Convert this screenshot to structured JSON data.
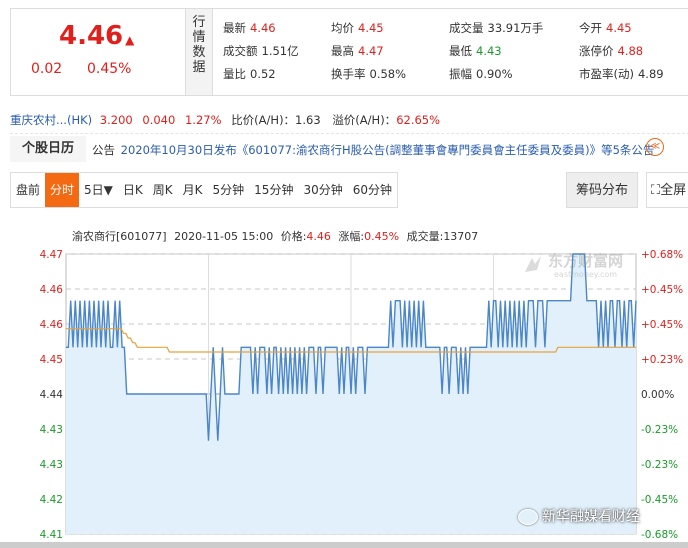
{
  "quote": {
    "price": "4.46",
    "up_icon": "▲",
    "change": "0.02",
    "change_pct": "0.45%",
    "vertical_label": [
      "行",
      "情",
      "数",
      "据"
    ],
    "fields": [
      {
        "label": "最新",
        "value": "4.46",
        "color": "red"
      },
      {
        "label": "均价",
        "value": "4.45",
        "color": "red"
      },
      {
        "label": "成交量",
        "value": "33.91万手",
        "color": ""
      },
      {
        "label": "今开",
        "value": "4.45",
        "color": "red"
      },
      {
        "label": "成交额",
        "value": "1.51亿",
        "color": ""
      },
      {
        "label": "最高",
        "value": "4.47",
        "color": "red"
      },
      {
        "label": "最低",
        "value": "4.43",
        "color": "green"
      },
      {
        "label": "涨停价",
        "value": "4.88",
        "color": "red"
      },
      {
        "label": "量比",
        "value": "0.52",
        "color": ""
      },
      {
        "label": "换手率",
        "value": "0.58%",
        "color": ""
      },
      {
        "label": "振幅",
        "value": "0.90%",
        "color": ""
      },
      {
        "label": "市盈率(动)",
        "value": "4.89",
        "color": ""
      }
    ]
  },
  "hk": {
    "name": "重庆农村...(HK)",
    "price": "3.200",
    "change": "0.040",
    "pct": "1.27%",
    "ratio_label": "比价(A/H)：1.63",
    "premium_label": "溢价(A/H)：",
    "premium_value": "62.65%"
  },
  "calendar": {
    "title": "个股日历",
    "prefix": "公告",
    "text": "2020年10月30日发布《601077:渝农商行H股公告(調整董事會專門委員會主任委員及委員)》等5条公告",
    "icon_text": "≪"
  },
  "tabs": [
    "盘前",
    "分时",
    "5日▼",
    "日K",
    "周K",
    "月K",
    "5分钟",
    "15分钟",
    "30分钟",
    "60分钟"
  ],
  "active_tab": "分时",
  "buttons": {
    "chip": "筹码分布",
    "full": "⛶全屏"
  },
  "chart_header": {
    "name": "渝农商行[601077]",
    "time": "2020-11-05 15:00",
    "price_label": "价格:",
    "price": "4.46",
    "pct_label": "涨幅:",
    "pct": "0.45%",
    "vol_label": "成交量:",
    "vol": "13707"
  },
  "watermark": {
    "brand": "东方财富网",
    "site": "eastmoney.com"
  },
  "credit": "新华融媒看财经",
  "colors": {
    "up": "#e0201d",
    "down": "#1a9a28",
    "price_line": "#4a86c8",
    "avg_line": "#e6a23c",
    "fill": "#e1f0fb",
    "grid": "#c8c8c8",
    "accent": "#f36a12"
  },
  "chart_data": {
    "type": "line",
    "title": "",
    "ylim": [
      4.41,
      4.47
    ],
    "left_ticks": [
      "4.47",
      "4.46",
      "4.46",
      "4.45",
      "4.44",
      "4.43",
      "4.43",
      "4.42",
      "4.41"
    ],
    "right_ticks": [
      "+0.68%",
      "+0.45%",
      "+0.45%",
      "+0.23%",
      "0.00%",
      "-0.23%",
      "-0.23%",
      "-0.45%",
      "-0.68%"
    ],
    "left_tick_values": [
      4.47,
      4.4625,
      4.455,
      4.4475,
      4.44,
      4.4325,
      4.425,
      4.4175,
      4.41
    ],
    "prev_close": 4.44,
    "x_index_range": [
      0,
      240
    ],
    "series": [
      {
        "values": [
          4.45,
          4.45,
          4.46,
          4.45,
          4.46,
          4.45,
          4.46,
          4.45,
          4.46,
          4.45,
          4.46,
          4.45,
          4.46,
          4.45,
          4.46,
          4.45,
          4.46,
          4.45,
          4.46,
          4.45,
          4.45,
          4.46,
          4.45,
          4.46,
          4.45,
          4.45,
          4.44,
          4.44,
          4.44,
          4.44,
          4.44,
          4.44,
          4.44,
          4.44,
          4.44,
          4.44,
          4.44,
          4.44,
          4.44,
          4.44,
          4.44,
          4.44,
          4.44,
          4.44,
          4.44,
          4.44,
          4.44,
          4.44,
          4.44,
          4.44,
          4.44,
          4.44,
          4.44,
          4.44,
          4.44,
          4.44,
          4.44,
          4.44,
          4.44,
          4.44,
          4.44,
          4.43,
          4.44,
          4.45,
          4.44,
          4.43,
          4.44,
          4.45,
          4.44,
          4.44,
          4.44,
          4.44,
          4.44,
          4.44,
          4.44,
          4.45,
          4.45,
          4.45,
          4.45,
          4.45,
          4.44,
          4.45,
          4.44,
          4.45,
          4.45,
          4.45,
          4.44,
          4.45,
          4.44,
          4.45,
          4.45,
          4.44,
          4.45,
          4.44,
          4.45,
          4.44,
          4.45,
          4.44,
          4.45,
          4.44,
          4.45,
          4.44,
          4.45,
          4.44,
          4.45,
          4.45,
          4.45,
          4.44,
          4.45,
          4.45,
          4.44,
          4.45,
          4.45,
          4.45,
          4.45,
          4.45,
          4.45,
          4.44,
          4.45,
          4.44,
          4.45,
          4.45,
          4.44,
          4.45,
          4.44,
          4.45,
          4.45,
          4.45,
          4.44,
          4.45,
          4.45,
          4.45,
          4.45,
          4.45,
          4.45,
          4.45,
          4.45,
          4.45,
          4.45,
          4.46,
          4.45,
          4.46,
          4.46,
          4.46,
          4.45,
          4.46,
          4.45,
          4.46,
          4.45,
          4.46,
          4.45,
          4.46,
          4.45,
          4.46,
          4.45,
          4.45,
          4.45,
          4.45,
          4.45,
          4.45,
          4.45,
          4.44,
          4.45,
          4.45,
          4.44,
          4.45,
          4.45,
          4.45,
          4.44,
          4.45,
          4.44,
          4.45,
          4.44,
          4.45,
          4.45,
          4.45,
          4.45,
          4.45,
          4.45,
          4.45,
          4.45,
          4.46,
          4.45,
          4.46,
          4.46,
          4.45,
          4.46,
          4.45,
          4.46,
          4.45,
          4.46,
          4.45,
          4.46,
          4.45,
          4.46,
          4.45,
          4.46,
          4.45,
          4.46,
          4.46,
          4.46,
          4.45,
          4.46,
          4.46,
          4.46,
          4.45,
          4.46,
          4.46,
          4.46,
          4.46,
          4.46,
          4.46,
          4.46,
          4.46,
          4.46,
          4.46,
          4.46,
          4.47,
          4.47,
          4.47,
          4.47,
          4.47,
          4.47,
          4.46,
          4.46,
          4.46,
          4.46,
          4.46,
          4.45,
          4.46,
          4.45,
          4.46,
          4.45,
          4.46,
          4.46,
          4.45,
          4.46,
          4.46,
          4.45,
          4.46,
          4.45,
          4.46,
          4.46,
          4.45,
          4.46
        ]
      },
      {
        "values": [
          4.454,
          4.454,
          4.454,
          4.454,
          4.454,
          4.454,
          4.454,
          4.454,
          4.454,
          4.454,
          4.454,
          4.454,
          4.454,
          4.454,
          4.454,
          4.454,
          4.454,
          4.454,
          4.454,
          4.454,
          4.454,
          4.454,
          4.454,
          4.454,
          4.454,
          4.453,
          4.453,
          4.452,
          4.452,
          4.451,
          4.451,
          4.45,
          4.45,
          4.45,
          4.45,
          4.45,
          4.45,
          4.45,
          4.45,
          4.45,
          4.45,
          4.45,
          4.45,
          4.45,
          4.45,
          4.449,
          4.449,
          4.449,
          4.449,
          4.449,
          4.449,
          4.449,
          4.449,
          4.449,
          4.449,
          4.449,
          4.449,
          4.449,
          4.449,
          4.449,
          4.449,
          4.449,
          4.449,
          4.449,
          4.449,
          4.449,
          4.449,
          4.449,
          4.449,
          4.449,
          4.449,
          4.449,
          4.449,
          4.449,
          4.449,
          4.449,
          4.449,
          4.449,
          4.449,
          4.449,
          4.449,
          4.449,
          4.449,
          4.449,
          4.449,
          4.449,
          4.449,
          4.449,
          4.449,
          4.449,
          4.449,
          4.449,
          4.449,
          4.449,
          4.449,
          4.449,
          4.449,
          4.449,
          4.449,
          4.449,
          4.449,
          4.449,
          4.449,
          4.449,
          4.449,
          4.449,
          4.449,
          4.449,
          4.449,
          4.449,
          4.449,
          4.449,
          4.449,
          4.449,
          4.449,
          4.449,
          4.449,
          4.449,
          4.449,
          4.449,
          4.449,
          4.449,
          4.449,
          4.449,
          4.449,
          4.449,
          4.449,
          4.449,
          4.449,
          4.449,
          4.449,
          4.449,
          4.449,
          4.449,
          4.449,
          4.449,
          4.449,
          4.449,
          4.449,
          4.449,
          4.449,
          4.449,
          4.449,
          4.449,
          4.449,
          4.449,
          4.449,
          4.449,
          4.449,
          4.449,
          4.449,
          4.449,
          4.449,
          4.449,
          4.449,
          4.449,
          4.449,
          4.449,
          4.449,
          4.449,
          4.449,
          4.449,
          4.449,
          4.449,
          4.449,
          4.449,
          4.449,
          4.449,
          4.449,
          4.449,
          4.449,
          4.449,
          4.449,
          4.449,
          4.449,
          4.449,
          4.449,
          4.449,
          4.449,
          4.449,
          4.449,
          4.449,
          4.449,
          4.449,
          4.449,
          4.449,
          4.449,
          4.449,
          4.449,
          4.449,
          4.449,
          4.449,
          4.449,
          4.449,
          4.449,
          4.449,
          4.449,
          4.449,
          4.449,
          4.449,
          4.449,
          4.449,
          4.449,
          4.449,
          4.449,
          4.449,
          4.449,
          4.449,
          4.449,
          4.449,
          4.449,
          4.449,
          4.449,
          4.449,
          4.45,
          4.45,
          4.45,
          4.45,
          4.45,
          4.45,
          4.45,
          4.45,
          4.45,
          4.45,
          4.45,
          4.45,
          4.45,
          4.45,
          4.45,
          4.45,
          4.45,
          4.45,
          4.45,
          4.45,
          4.45,
          4.45,
          4.45,
          4.45,
          4.45,
          4.45,
          4.45,
          4.45,
          4.45,
          4.45,
          4.45,
          4.45,
          4.45,
          4.45,
          4.45
        ]
      }
    ]
  }
}
